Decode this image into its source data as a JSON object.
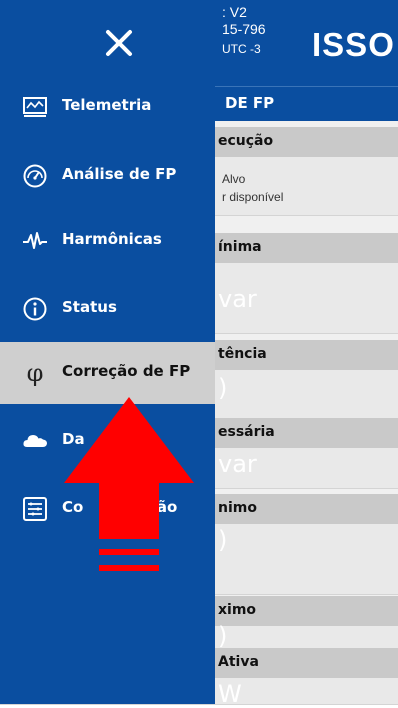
{
  "background": {
    "header": {
      "line1": ": V2",
      "line2": "15-796",
      "line3": "UTC -3",
      "brand": "ISSO"
    },
    "subtitle": "DE FP",
    "sections": [
      {
        "header": "ecução",
        "lines": [
          "Alvo",
          "r disponível"
        ]
      },
      {
        "header": "ínima",
        "value": "var"
      },
      {
        "header": "tência",
        "value": ")"
      },
      {
        "header": "essária",
        "value": "var"
      },
      {
        "header": "nimo",
        "value": ")"
      },
      {
        "header": "ximo",
        "value": ")"
      },
      {
        "header": "Ativa",
        "value": "W"
      }
    ]
  },
  "drawer": {
    "close_icon": "close-icon",
    "items": [
      {
        "label": "Telemetria",
        "icon": "telemetry-icon",
        "active": false
      },
      {
        "label": "Análise de FP",
        "icon": "speedometer-icon",
        "active": false
      },
      {
        "label": "Harmônicas",
        "icon": "pulse-icon",
        "active": false
      },
      {
        "label": "Status",
        "icon": "info-icon",
        "active": false
      },
      {
        "label": "Correção de FP",
        "icon": "phi-icon",
        "active": true
      },
      {
        "label": "Da",
        "icon": "cloud-icon",
        "active": false
      },
      {
        "label": "Co",
        "label_tail": "ção",
        "icon": "settings-list-icon",
        "active": false
      }
    ]
  },
  "overlay": {
    "icon": "red-up-arrow-icon",
    "color": "#ff0000"
  },
  "colors": {
    "primary": "#0a4ea0",
    "active_bg": "#cfcfcf",
    "section_header": "#c9c9c9"
  }
}
